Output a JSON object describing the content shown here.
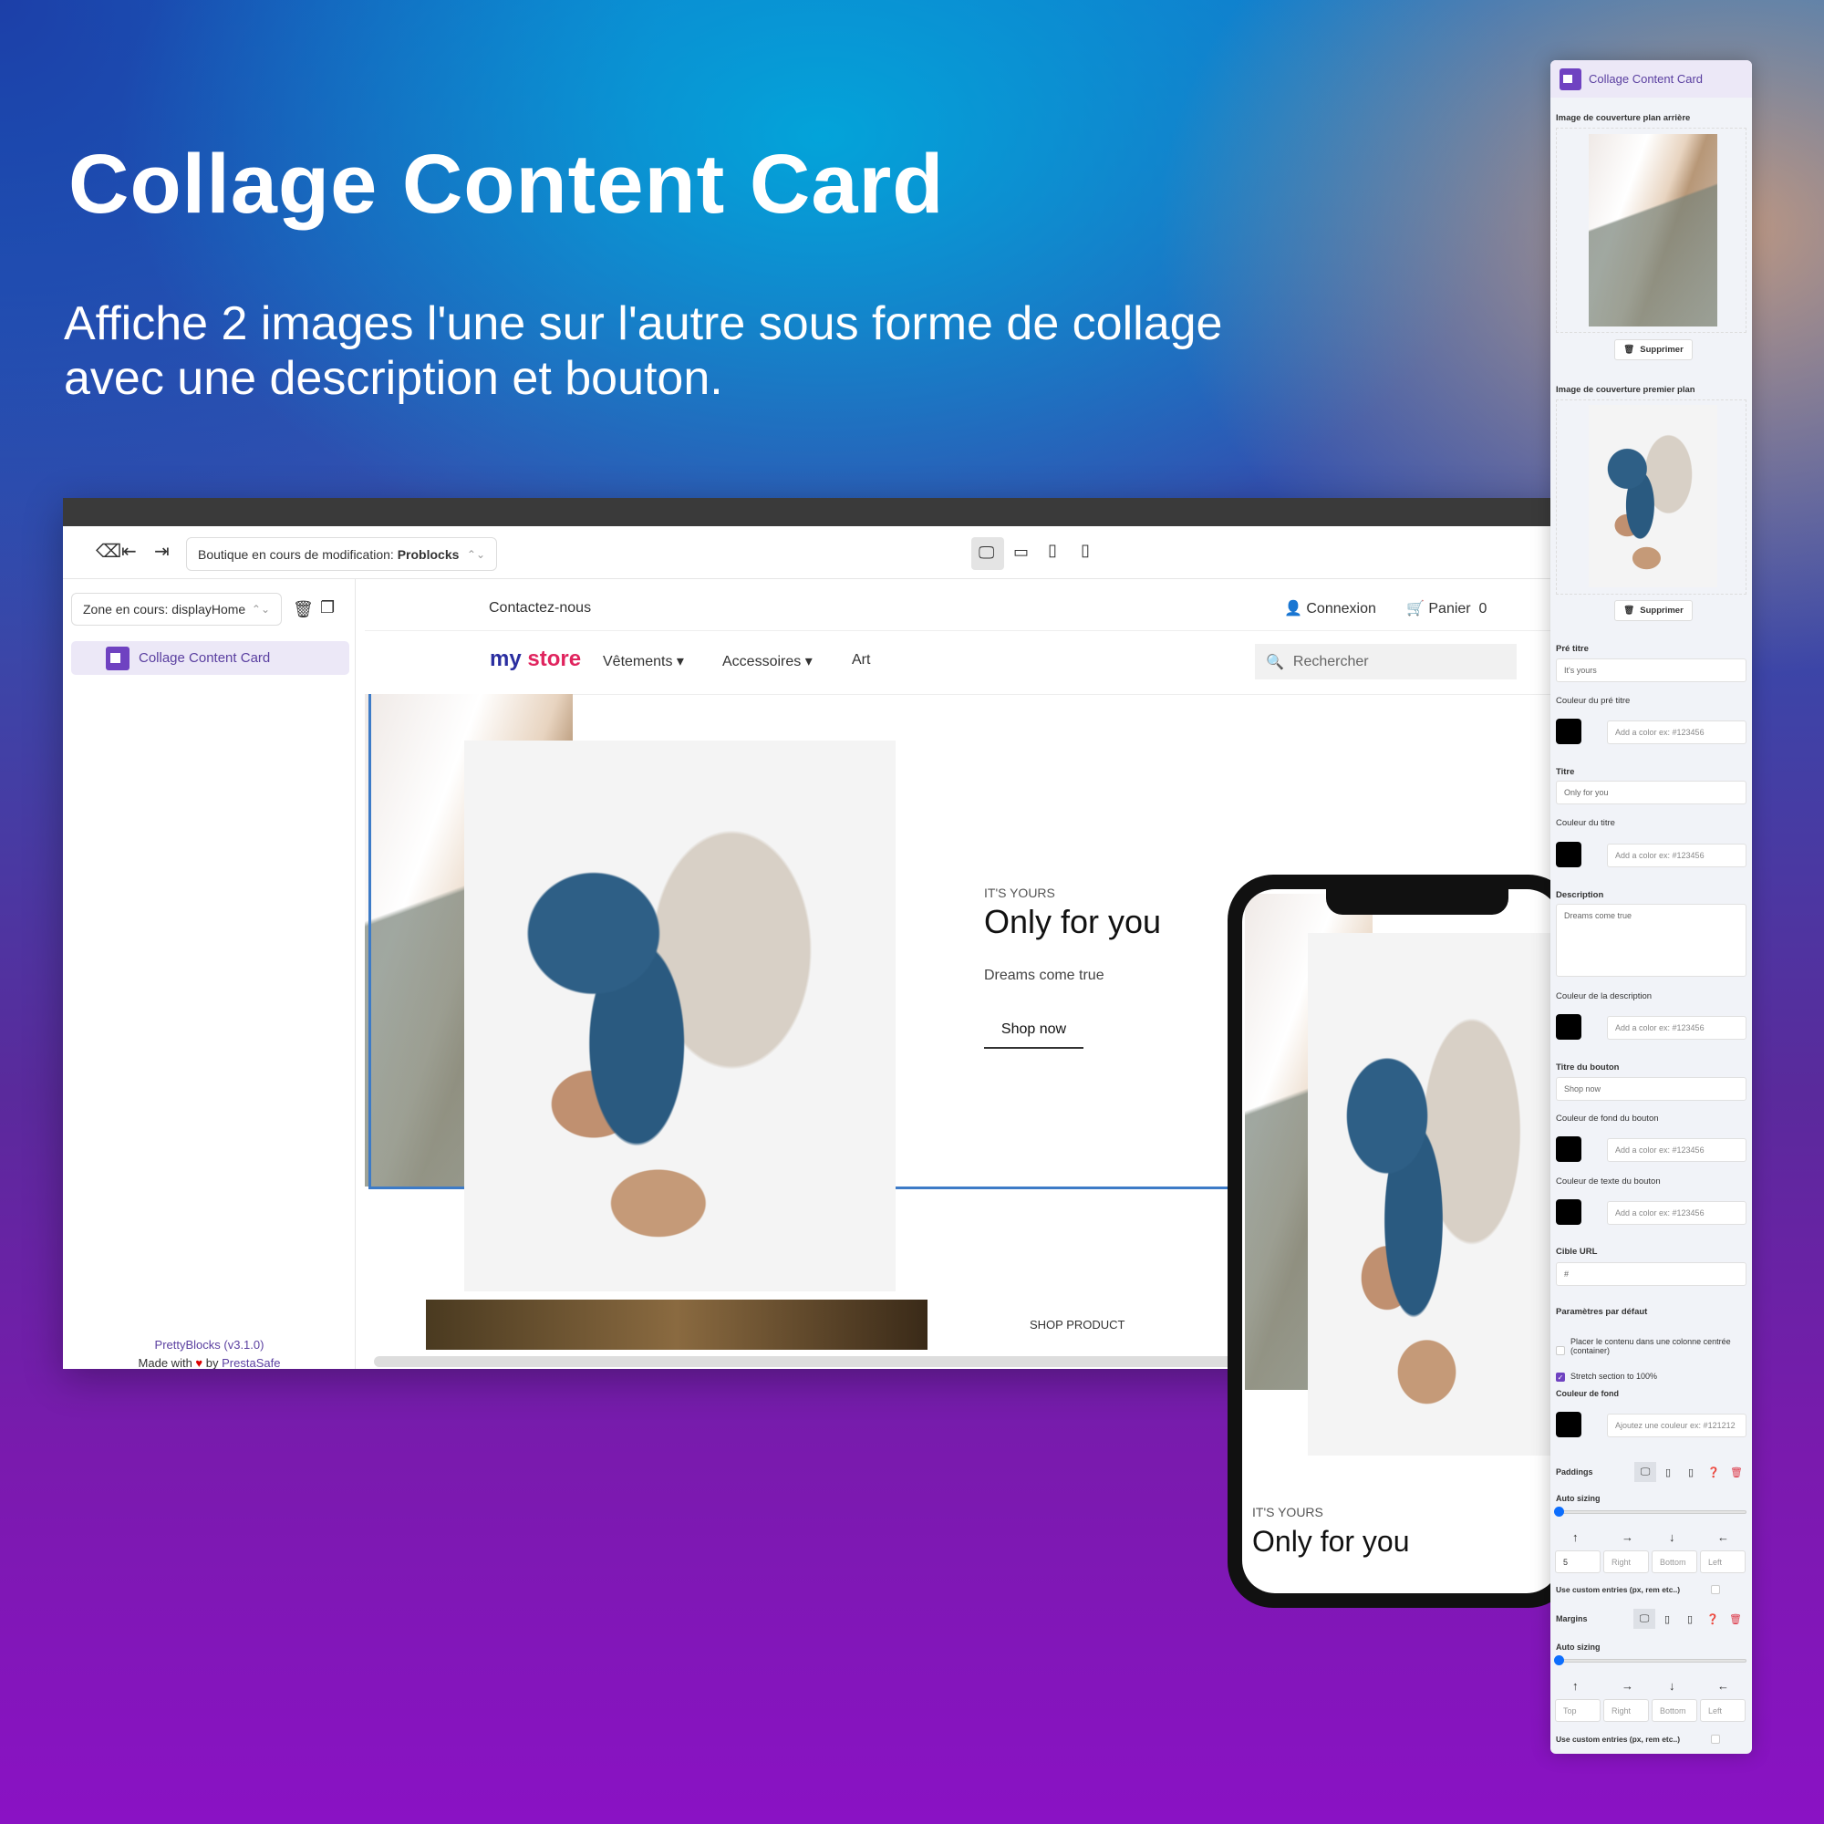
{
  "hero": {
    "title": "Collage Content Card",
    "subtitle_line1": "Affiche 2 images l'une sur l'autre sous forme de collage",
    "subtitle_line2": "avec une description et bouton."
  },
  "toolbar": {
    "shop_select_prefix": "Boutique en cours de modification: ",
    "shop_select_value": "Problocks",
    "devices": [
      "desktop-icon",
      "tablet-landscape-icon",
      "tablet-icon",
      "mobile-icon"
    ],
    "active_device": "desktop"
  },
  "sidebar": {
    "zone_select": "Zone en cours: displayHome",
    "items": [
      {
        "label": "Collage Content Card"
      }
    ],
    "footer_version": "PrettyBlocks (v3.1.0)",
    "footer_made_with": "Made with",
    "footer_by": "by",
    "footer_author": "PrestaSafe"
  },
  "store": {
    "contact": "Contactez-nous",
    "login": "Connexion",
    "cart": "Panier",
    "cart_count": "0",
    "logo_my": "my",
    "logo_store": "store",
    "nav": [
      "Vêtements",
      "Accessoires",
      "Art"
    ],
    "search_placeholder": "Rechercher",
    "card": {
      "pretitle": "IT'S YOURS",
      "title": "Only for you",
      "description": "Dreams come true",
      "button": "Shop now"
    },
    "next_section_label": "SHOP PRODUCT"
  },
  "phone": {
    "pretitle": "IT'S YOURS",
    "title": "Only for you"
  },
  "panel": {
    "title": "Collage Content Card",
    "back_image_label": "Image de couverture plan arrière",
    "front_image_label": "Image de couverture premier plan",
    "delete_label": "Supprimer",
    "pretitle_label": "Pré titre",
    "pretitle_value": "It's yours",
    "pretitle_color_label": "Couleur du pré titre",
    "color_placeholder": "Add a color ex: #123456",
    "title_label": "Titre",
    "title_value": "Only for you",
    "title_color_label": "Couleur du titre",
    "description_label": "Description",
    "description_value": "Dreams come true",
    "description_color_label": "Couleur de la description",
    "button_title_label": "Titre du bouton",
    "button_title_value": "Shop now",
    "button_bg_color_label": "Couleur de fond du bouton",
    "button_text_color_label": "Couleur de texte du bouton",
    "url_label": "Cible URL",
    "url_value": "#",
    "defaults_label": "Paramètres par défaut",
    "container_label": "Placer le contenu dans une colonne centrée (container)",
    "container_checked": false,
    "stretch_label": "Stretch section to 100%",
    "stretch_checked": true,
    "bg_color_label": "Couleur de fond",
    "bg_color_placeholder": "Ajoutez une couleur ex: #121212",
    "paddings_label": "Paddings",
    "margins_label": "Margins",
    "auto_sizing_label": "Auto sizing",
    "auto_sizing_value": 0,
    "padding_values": {
      "top": "5",
      "right": "",
      "bottom": "",
      "left": ""
    },
    "placeholders": {
      "top": "Top",
      "right": "Right",
      "bottom": "Bottom",
      "left": "Left"
    },
    "custom_entries_label": "Use custom entries (px, rem etc..)",
    "custom_entries_checked": false,
    "swatch_color": "#000000"
  },
  "colors": {
    "accent": "#6f42c1",
    "slider": "#0d6efd",
    "delete": "#dc3545",
    "selection_border": "#3d7bc7"
  }
}
